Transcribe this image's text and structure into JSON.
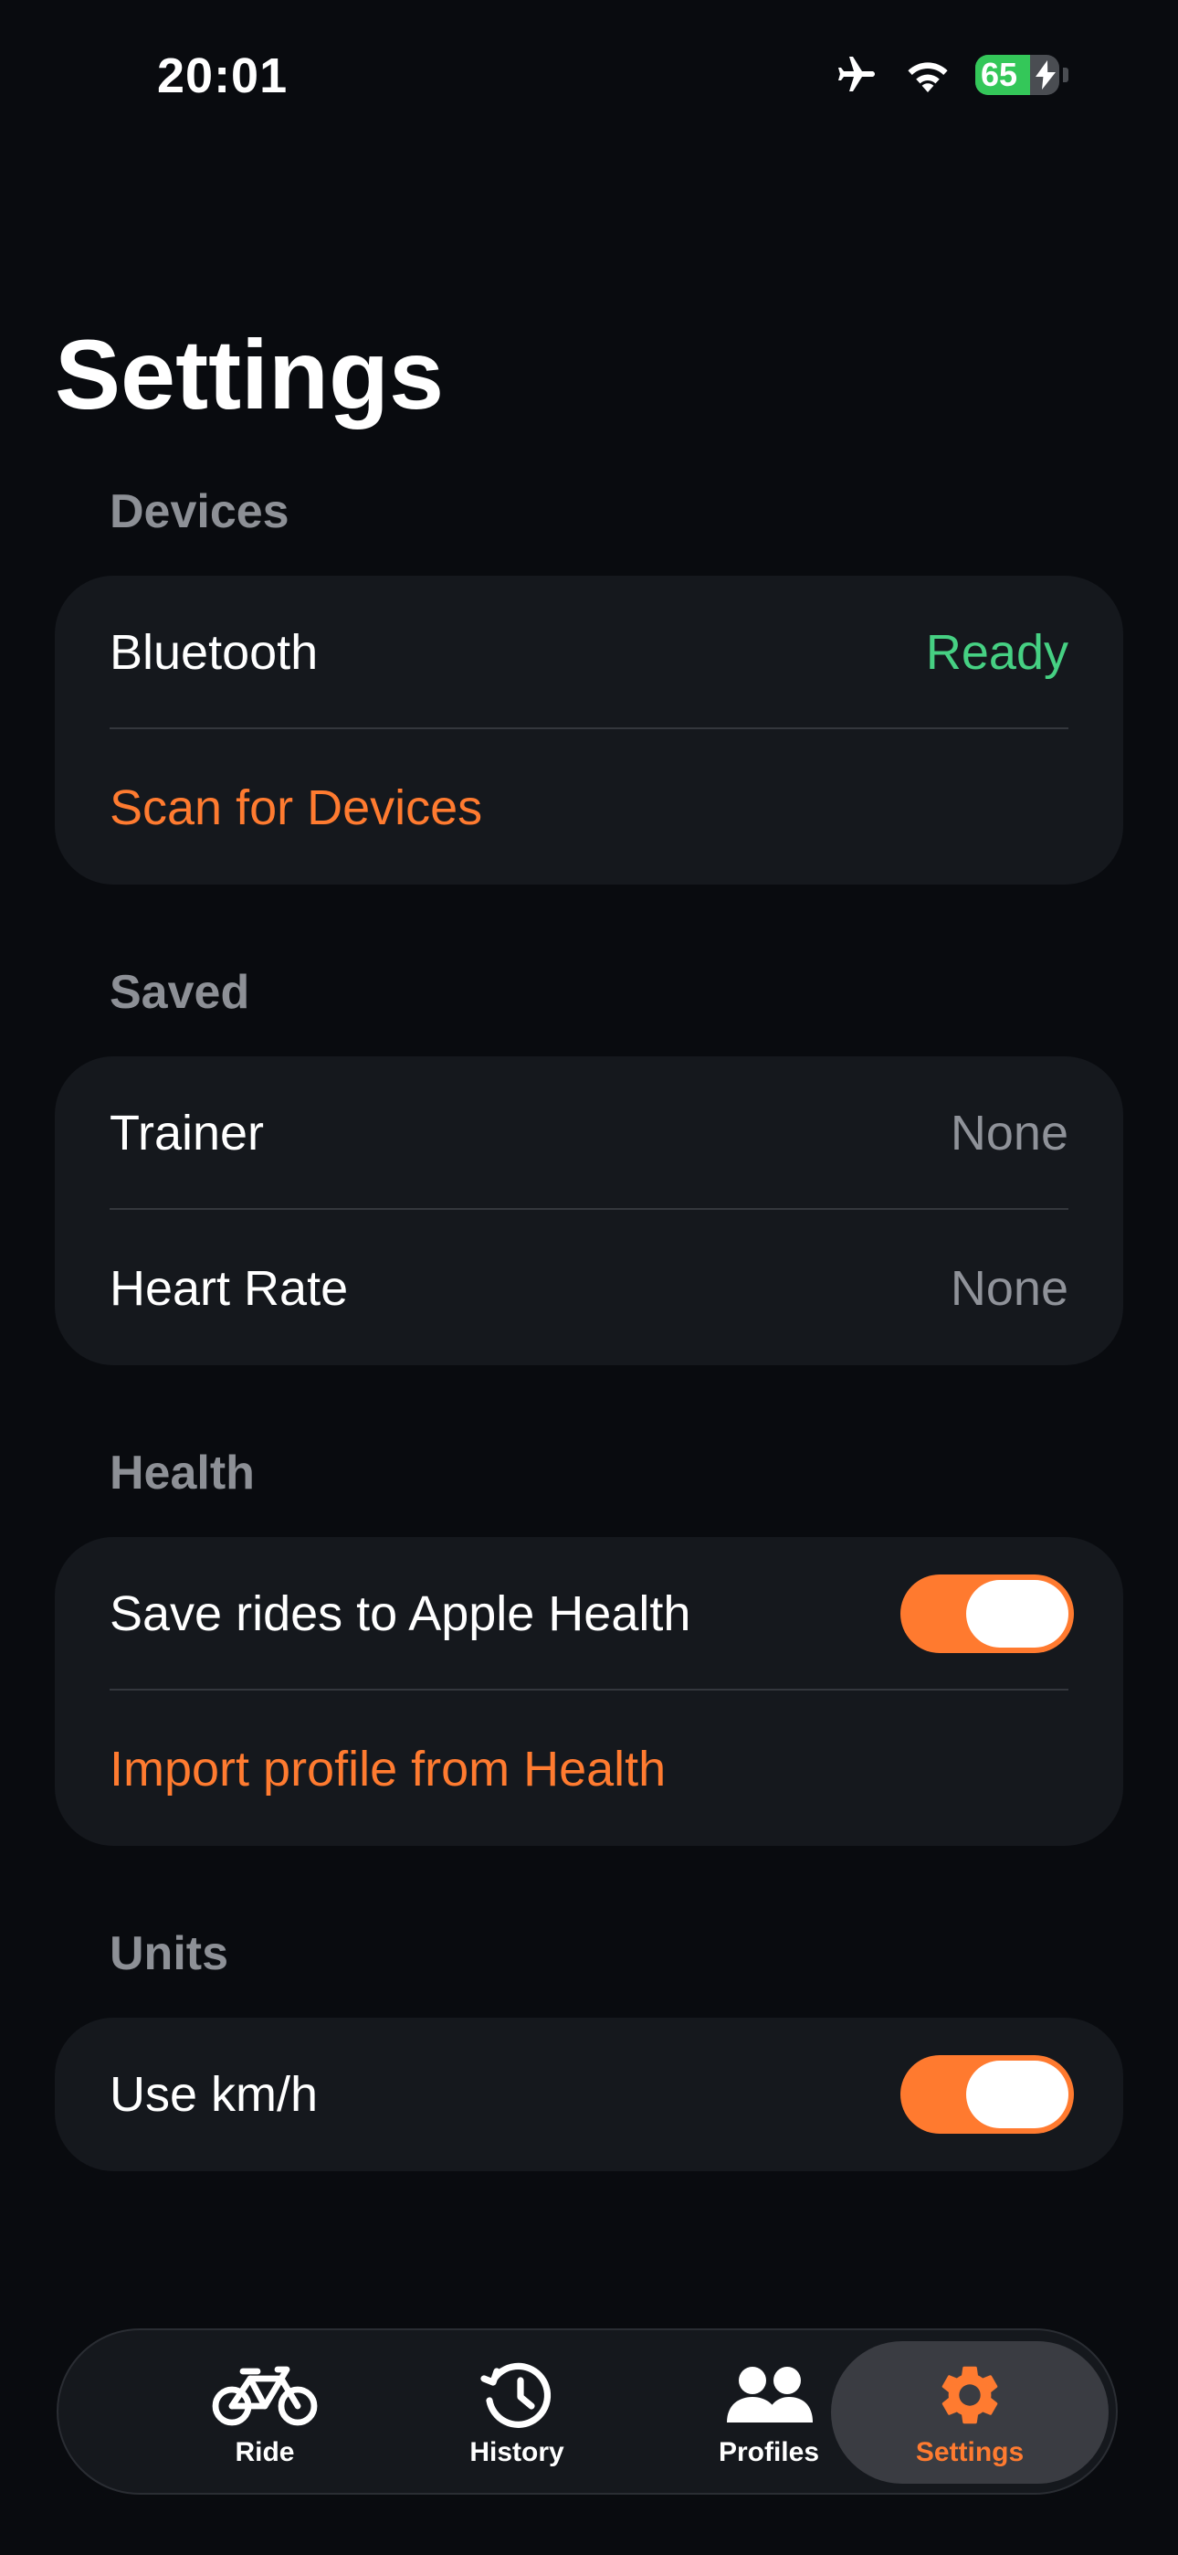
{
  "status_bar": {
    "time": "20:01",
    "battery_level": "65",
    "battery_fraction": 0.65,
    "icons": [
      "airplane-icon",
      "wifi-icon",
      "battery-charging-icon"
    ]
  },
  "title": "Settings",
  "sections": {
    "devices": {
      "header": "Devices",
      "bluetooth_label": "Bluetooth",
      "bluetooth_status": "Ready",
      "scan_label": "Scan for Devices"
    },
    "saved": {
      "header": "Saved",
      "trainer_label": "Trainer",
      "trainer_value": "None",
      "heart_rate_label": "Heart Rate",
      "heart_rate_value": "None"
    },
    "health": {
      "header": "Health",
      "save_rides_label": "Save rides to Apple Health",
      "save_rides_on": true,
      "import_label": "Import profile from Health"
    },
    "units": {
      "header": "Units",
      "kmh_label": "Use km/h",
      "kmh_on": true
    }
  },
  "tab_bar": {
    "tabs": [
      {
        "label": "Ride",
        "icon": "bicycle-icon",
        "active": false
      },
      {
        "label": "History",
        "icon": "history-icon",
        "active": false
      },
      {
        "label": "Profiles",
        "icon": "profiles-icon",
        "active": false
      },
      {
        "label": "Settings",
        "icon": "gear-icon",
        "active": true
      }
    ]
  },
  "colors": {
    "background": "#090b0f",
    "card": "#15181d",
    "accent": "#ff7b30",
    "ready_green": "#46d083",
    "secondary_text": "#8f9299"
  }
}
